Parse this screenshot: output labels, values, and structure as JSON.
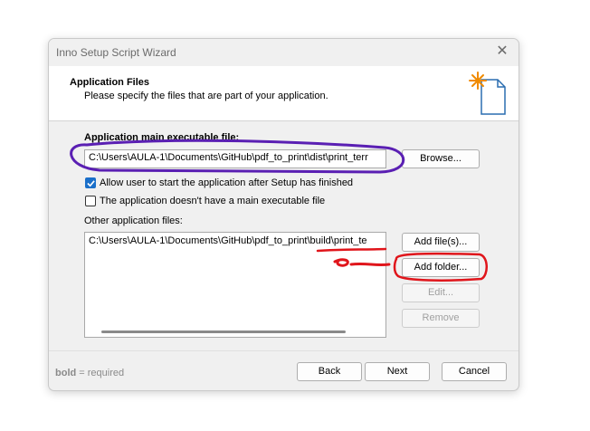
{
  "window": {
    "title": "Inno Setup Script Wizard",
    "close_glyph": "✕"
  },
  "header": {
    "title": "Application Files",
    "subtitle": "Please specify the files that are part of your application.",
    "icon": "document-sparkle-icon"
  },
  "main_exe": {
    "label": "Application main executable file:",
    "value": "C:\\Users\\AULA-1\\Documents\\GitHub\\pdf_to_print\\dist\\print_terr",
    "browse_label": "Browse..."
  },
  "options": {
    "allow_start": {
      "label": "Allow user to start the application after Setup has finished",
      "checked": true
    },
    "no_main_exe": {
      "label": "The application doesn't have a main executable file",
      "checked": false
    }
  },
  "other_files": {
    "label": "Other application files:",
    "items": [
      "C:\\Users\\AULA-1\\Documents\\GitHub\\pdf_to_print\\build\\print_te"
    ],
    "add_files_label": "Add file(s)...",
    "add_folder_label": "Add folder...",
    "edit_label": "Edit...",
    "remove_label": "Remove"
  },
  "footer": {
    "required_bold": "bold",
    "required_text": "= required",
    "back_label": "Back",
    "next_label": "Next",
    "cancel_label": "Cancel"
  },
  "annotation_colors": {
    "purple": "#5a1fb3",
    "red": "#e0151b"
  }
}
